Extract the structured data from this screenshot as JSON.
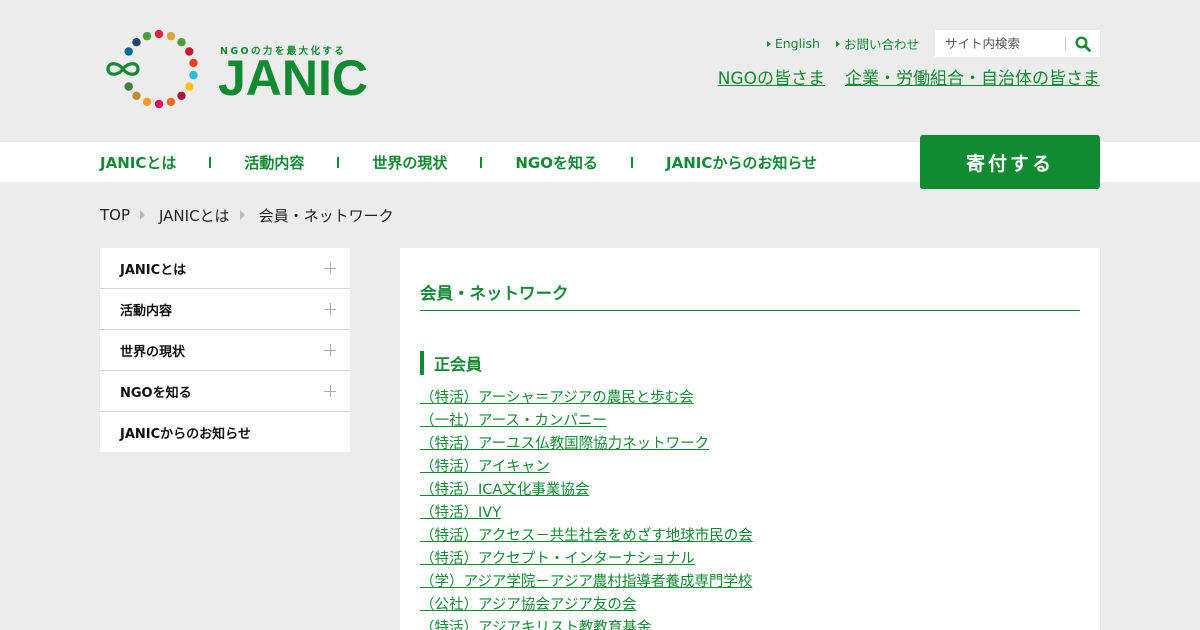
{
  "header": {
    "tagline": "NGOの力を最大化する",
    "brand": "JANIC",
    "util_links": [
      {
        "label": "English"
      },
      {
        "label": "お問い合わせ"
      }
    ],
    "search": {
      "placeholder": "サイト内検索",
      "icon": "search-icon"
    },
    "audience_links": [
      {
        "label": "NGOの皆さま"
      },
      {
        "label": "企業・労働組合・自治体の皆さま"
      }
    ]
  },
  "nav": {
    "items": [
      {
        "label": "JANICとは"
      },
      {
        "label": "活動内容"
      },
      {
        "label": "世界の現状"
      },
      {
        "label": "NGOを知る"
      },
      {
        "label": "JANICからのお知らせ"
      }
    ],
    "donate_label": "寄付する"
  },
  "breadcrumb": [
    "TOP",
    "JANICとは",
    "会員・ネットワーク"
  ],
  "sidebar": {
    "items": [
      {
        "label": "JANICとは",
        "expandable": true
      },
      {
        "label": "活動内容",
        "expandable": true
      },
      {
        "label": "世界の現状",
        "expandable": true
      },
      {
        "label": "NGOを知る",
        "expandable": true
      },
      {
        "label": "JANICからのお知らせ",
        "expandable": false
      }
    ]
  },
  "main": {
    "title": "会員・ネットワーク",
    "section_title": "正会員",
    "members": [
      "（特活）アーシャ＝アジアの農民と歩む会",
      "（一社）アース・カンパニー",
      "（特活）アーユス仏教国際協力ネットワーク",
      "（特活）アイキャン",
      "（特活）ICA文化事業協会",
      "（特活）IVY",
      "（特活）アクセス－共生社会をめざす地球市民の会",
      "（特活）アクセプト・インターナショナル",
      "（学）アジア学院－アジア農村指導者養成専門学校",
      "（公社）アジア協会アジア友の会",
      "（特活）アジアキリスト教教育基金"
    ]
  },
  "colors": {
    "brand_green": "#128a32",
    "page_bg": "#ececec",
    "panel_bg": "#ffffff"
  }
}
